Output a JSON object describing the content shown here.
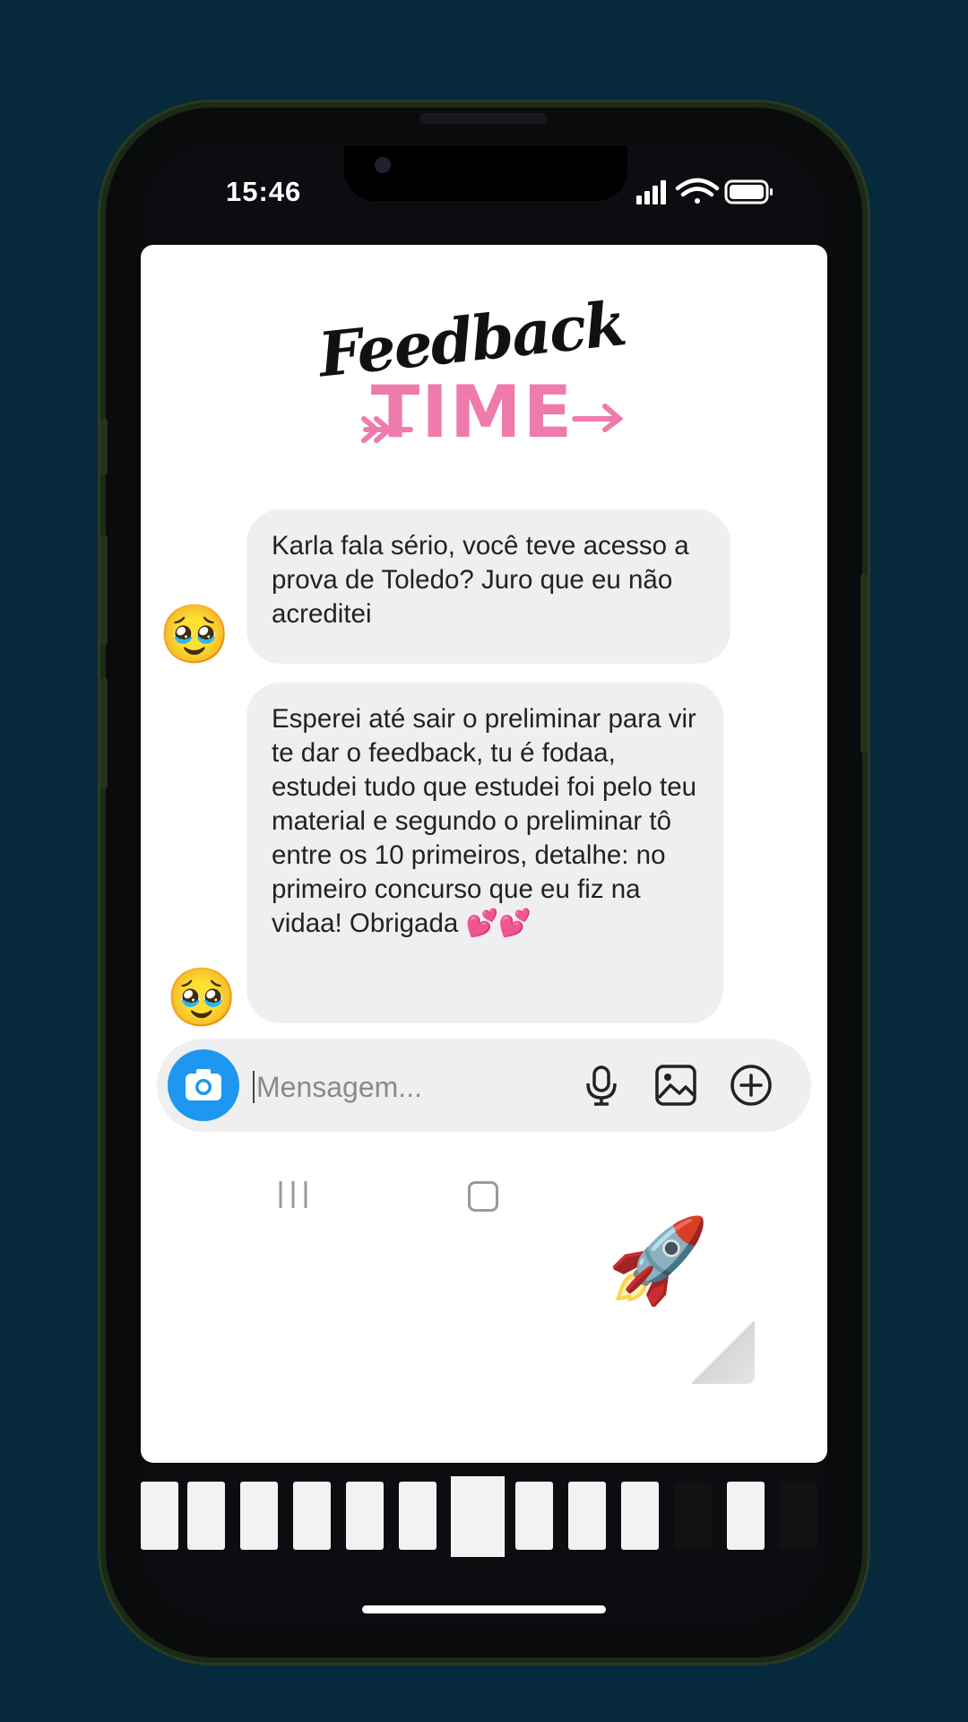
{
  "status_bar": {
    "time": "15:46"
  },
  "story": {
    "title_line1": "Feedback",
    "title_line2": "TIME",
    "messages": [
      {
        "text": "Karla fala sério, você teve acesso a prova de Toledo? Juro que eu não acreditei",
        "avatar_emoji": "🥹"
      },
      {
        "text": "Esperei até sair o preliminar para vir te dar o feedback, tu é fodaa, estudei tudo que estudei foi pelo teu material e segundo o preliminar tô entre os 10 primeiros, detalhe: no primeiro concurso que eu fiz na vidaa! Obrigada 💕💕",
        "avatar_emoji": "🥹"
      }
    ],
    "composer": {
      "placeholder": "Mensagem..."
    },
    "sticker_emoji": "🚀"
  },
  "colors": {
    "accent_pink": "#ef7aac",
    "camera_blue": "#1e97f0",
    "background": "#062a3b"
  }
}
